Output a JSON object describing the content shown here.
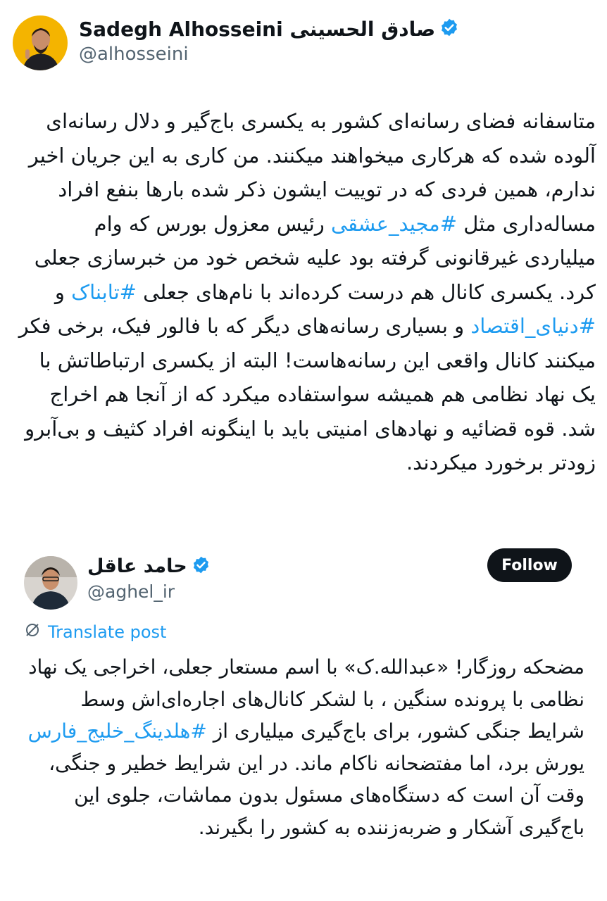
{
  "main_post": {
    "author_name": "Sadegh Alhosseini صادق الحسینی",
    "handle": "@alhosseini",
    "verified": true,
    "text_parts": [
      {
        "t": "متاسفانه فضای رسانه‌ای کشور به یکسری باج‌گیر و دلال رسانه‌ای آلوده شده که هرکاری میخواهند میکنند. من کاری به این جریان اخیر ندارم، همین فردی که در توییت ایشون ذکر شده بارها بنفع افراد مساله‌داری مثل "
      },
      {
        "tag": "#مجید_عشقی"
      },
      {
        "t": " رئیس معزول بورس که وام میلیاردی غیرقانونی گرفته بود علیه شخص خود من خبرسازی جعلی کرد. یکسری کانال هم درست کرده‌اند با نام‌های جعلی "
      },
      {
        "tag": "#تابناک"
      },
      {
        "t": " و "
      },
      {
        "tag": "#دنیای_اقتصاد"
      },
      {
        "t": " و بسیاری رسانه‌های دیگر که با فالور فیک، برخی فکر میکنند کانال واقعی این رسانه‌هاست! البته از یکسری ارتباطاتش با یک نهاد نظامی هم همیشه سواستفاده میکرد که از آنجا هم اخراج شد. قوه قضائیه و نهادهای امنیتی باید با اینگونه افراد کثیف و بی‌آبرو زودتر برخورد میکردند."
      }
    ]
  },
  "quoted_post": {
    "author_name": "حامد عاقل",
    "handle": "@aghel_ir",
    "verified": true,
    "follow_label": "Follow",
    "translate_label": "Translate post",
    "text_parts": [
      {
        "t": "مضحکه روزگار! «عبدالله.ک» با اسم مستعار جعلی، اخراجی یک نهاد نظامی با پرونده سنگین ، با لشکر کانال‌های اجاره‌ای‌اش وسط شرایط جنگی کشور، برای باج‌گیری میلیاری از "
      },
      {
        "tag": "#هلدینگ_خلیج_فارس"
      },
      {
        "t": " یورش برد، اما مفتضحانه ناکام ماند. در این شرایط خطیر و جنگی، وقت آن است که دستگاه‌های مسئول بدون مماشات، جلوی این باج‌گیری آشکار و ضربه‌زننده به کشور را بگیرند."
      }
    ]
  },
  "colors": {
    "link": "#1d9bf0",
    "verified_badge": "#1d9bf0",
    "text": "#0f1419",
    "secondary": "#536471",
    "follow_bg": "#0f1419"
  }
}
